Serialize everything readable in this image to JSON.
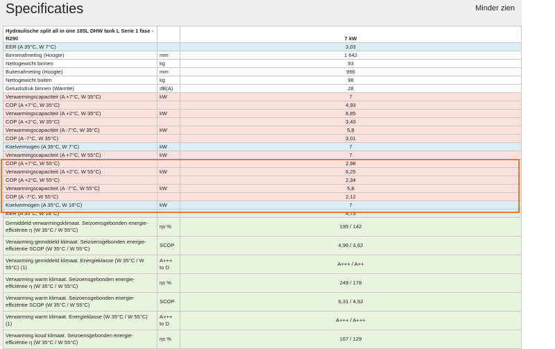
{
  "header": {
    "title": "Specificaties",
    "toggle_label": "Minder zien"
  },
  "table": {
    "product_name": "Hydraulische split all in one 185L DHW tank L Serie 1 fase - R290",
    "model": "7 kW",
    "rows": [
      {
        "label": "EER (A 35°C, W 7°C)",
        "unit": "",
        "value": "3,03",
        "color": "blue"
      },
      {
        "label": "Binnenafmeting (Hoogte)",
        "unit": "mm",
        "value": "1 642",
        "color": "white"
      },
      {
        "label": "Nettogewicht binnen",
        "unit": "kg",
        "value": "93",
        "color": "white"
      },
      {
        "label": "Buitenafmeting (Hoogte)",
        "unit": "mm",
        "value": "996",
        "color": "white"
      },
      {
        "label": "Nettogewicht buiten",
        "unit": "kg",
        "value": "98",
        "color": "white"
      },
      {
        "label": "Geluidsdruk binnen (Warmte)",
        "unit": "dB(A)",
        "value": "28",
        "color": "white"
      },
      {
        "label": "Verwarmingscapaciteit (A +7°C, W 35°C)",
        "unit": "kW",
        "value": "7",
        "color": "pink"
      },
      {
        "label": "COP (A +7°C, W 35°C)",
        "unit": "",
        "value": "4,93",
        "color": "pink"
      },
      {
        "label": "Verwarmingscapaciteit (A +2°C, W 35°C)",
        "unit": "kW",
        "value": "6,85",
        "color": "pink"
      },
      {
        "label": "COP (A +2°C, W 35°C)",
        "unit": "",
        "value": "3,43",
        "color": "pink"
      },
      {
        "label": "Verwarmingscapaciteit (A -7°C, W 35°C)",
        "unit": "kW",
        "value": "5,8",
        "color": "pink"
      },
      {
        "label": "COP (A -7°C, W 35°C)",
        "unit": "",
        "value": "3,01",
        "color": "pink"
      },
      {
        "label": "Koelvermogen (A 35°C, W 7°C)",
        "unit": "kW",
        "value": "7",
        "color": "blue"
      },
      {
        "label": "Verwarmingscapaciteit (A +7°C, W 55°C)",
        "unit": "kW",
        "value": "7",
        "color": "pink"
      },
      {
        "label": "COP (A +7°C, W 55°C)",
        "unit": "",
        "value": "2,98",
        "color": "pink"
      },
      {
        "label": "Verwarmingscapaciteit (A +2°C, W 55°C)",
        "unit": "kW",
        "value": "6,25",
        "color": "pink"
      },
      {
        "label": "COP (A +2°C, W 55°C)",
        "unit": "",
        "value": "2,34",
        "color": "pink"
      },
      {
        "label": "Verwarmingscapaciteit (A -7°C, W 55°C)",
        "unit": "kW",
        "value": "5,8",
        "color": "pink"
      },
      {
        "label": "COP (A -7°C, W 55°C)",
        "unit": "",
        "value": "2,12",
        "color": "pink"
      },
      {
        "label": "Koelvermogen (A 35°C, W 18°C)",
        "unit": "kW",
        "value": "7",
        "color": "blue"
      },
      {
        "label": "EER (A 35°C, W 18°C)",
        "unit": "",
        "value": "4,73",
        "color": "blue"
      },
      {
        "label": "Gemiddeld verwarmingsklimaat. Seizoensgebonden energie-efficiëntie η (W 35°C / W 55°C)",
        "unit": "ηs %",
        "value": "195 / 142",
        "color": "green"
      },
      {
        "label": "Verwarming gemiddeld klimaat. Seizoensgebonden energie-efficiëntie SCOP (W 35°C / W 55°C)",
        "unit": "SCOP",
        "value": "4,96 / 3,62",
        "color": "green"
      },
      {
        "label": "Verwarming gemiddeld klimaat. Energieklasse (W 35°C / W 55°C) (1)",
        "unit": "A+++ to D",
        "value": "A+++ / A++",
        "color": "green"
      },
      {
        "label": "Verwarming warm klimaat. Seizoensgebonden energie-efficiëntie η (W 35°C / W 55°C)",
        "unit": "ηs %",
        "value": "249 / 178",
        "color": "green"
      },
      {
        "label": "Verwarming warm klimaat. Seizoensgebonden energie-efficiëntie SCOP (W 35°C / W 55°C)",
        "unit": "SCOP",
        "value": "6,31 / 4,52",
        "color": "green"
      },
      {
        "label": "Verwarming warm klimaat. Energieklasse (W 35°C / W 55°C) (1)",
        "unit": "A+++ to D",
        "value": "A+++ / A+++",
        "color": "green"
      },
      {
        "label": "Verwarming koud klimaat. Seizoensgebonden energie-efficiëntie η (W 35°C / W 55°C)",
        "unit": "ηs %",
        "value": "167 / 129",
        "color": "green"
      }
    ]
  },
  "colors": {
    "highlight": "#f07427",
    "blue": "#daeef3",
    "pink": "#fbe0dc",
    "green": "#e8f4dd"
  }
}
